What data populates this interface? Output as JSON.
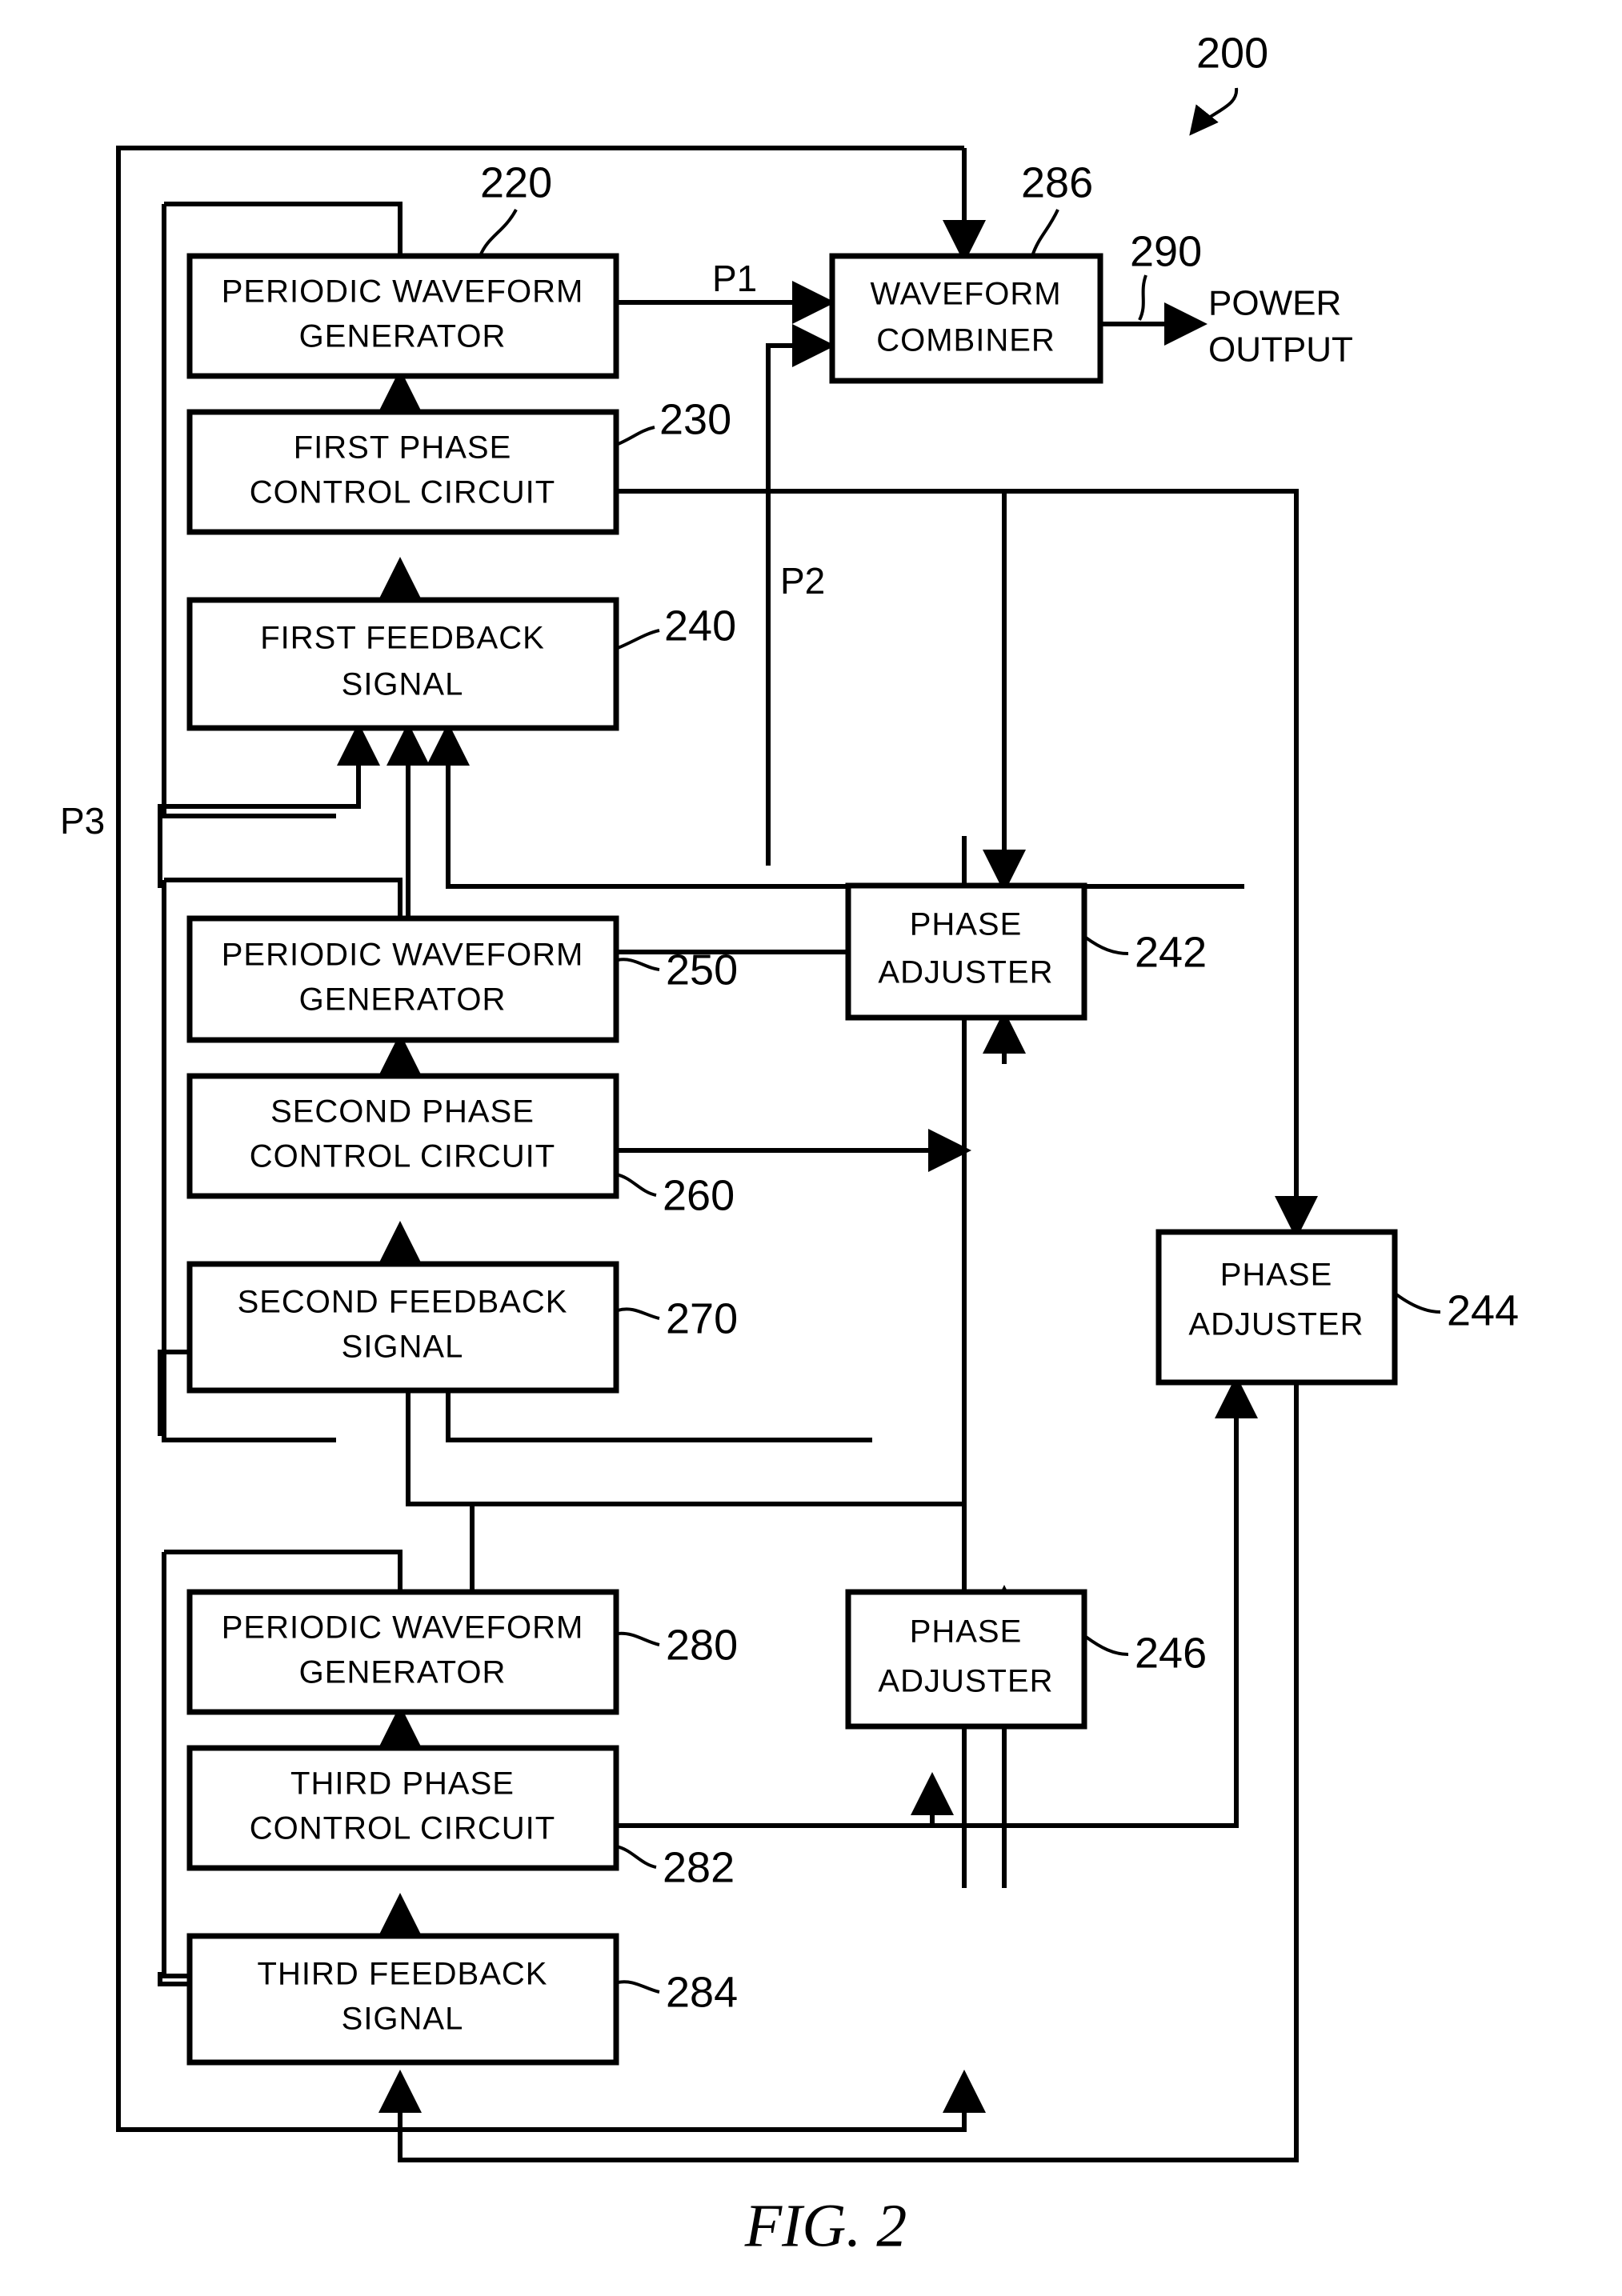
{
  "figure": {
    "caption": "FIG. 2",
    "system_ref": "200"
  },
  "blocks": [
    {
      "id": "pwg1",
      "line1": "PERIODIC WAVEFORM",
      "line2": "GENERATOR",
      "ref": "220"
    },
    {
      "id": "fpcc",
      "line1": "FIRST PHASE",
      "line2": "CONTROL CIRCUIT",
      "ref": "230"
    },
    {
      "id": "ffs",
      "line1": "FIRST FEEDBACK",
      "line2": "SIGNAL",
      "ref": "240"
    },
    {
      "id": "pwg2",
      "line1": "PERIODIC WAVEFORM",
      "line2": "GENERATOR",
      "ref": "250"
    },
    {
      "id": "spcc",
      "line1": "SECOND PHASE",
      "line2": "CONTROL CIRCUIT",
      "ref": "260"
    },
    {
      "id": "sfs",
      "line1": "SECOND FEEDBACK",
      "line2": "SIGNAL",
      "ref": "270"
    },
    {
      "id": "pwg3",
      "line1": "PERIODIC WAVEFORM",
      "line2": "GENERATOR",
      "ref": "280"
    },
    {
      "id": "tpcc",
      "line1": "THIRD PHASE",
      "line2": "CONTROL CIRCUIT",
      "ref": "282"
    },
    {
      "id": "tfs",
      "line1": "THIRD FEEDBACK",
      "line2": "SIGNAL",
      "ref": "284"
    },
    {
      "id": "comb",
      "line1": "WAVEFORM",
      "line2": "COMBINER",
      "ref": "286"
    },
    {
      "id": "pa1",
      "line1": "PHASE",
      "line2": "ADJUSTER",
      "ref": "242"
    },
    {
      "id": "pa2",
      "line1": "PHASE",
      "line2": "ADJUSTER",
      "ref": "244"
    },
    {
      "id": "pa3",
      "line1": "PHASE",
      "line2": "ADJUSTER",
      "ref": "246"
    }
  ],
  "signals": {
    "p1": "P1",
    "p2": "P2",
    "p3": "P3"
  },
  "output": {
    "ref": "290",
    "line1": "POWER",
    "line2": "OUTPUT"
  },
  "colors": {
    "stroke": "#000000",
    "background": "#ffffff"
  }
}
